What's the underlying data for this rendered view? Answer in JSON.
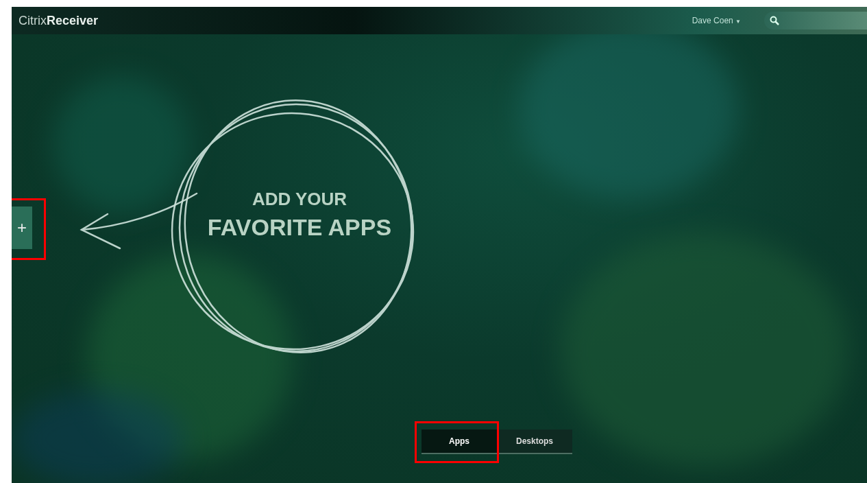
{
  "header": {
    "brand_light": "Citrix",
    "brand_bold": "Receiver",
    "user": "Dave Coen",
    "caret": "▼"
  },
  "add_button": {
    "label": "+"
  },
  "hero": {
    "line_1": "ADD YOUR",
    "line_2": "FAVORITE APPS"
  },
  "tabs": [
    {
      "label": "Apps",
      "selected": true
    },
    {
      "label": "Desktops",
      "selected": false
    }
  ]
}
